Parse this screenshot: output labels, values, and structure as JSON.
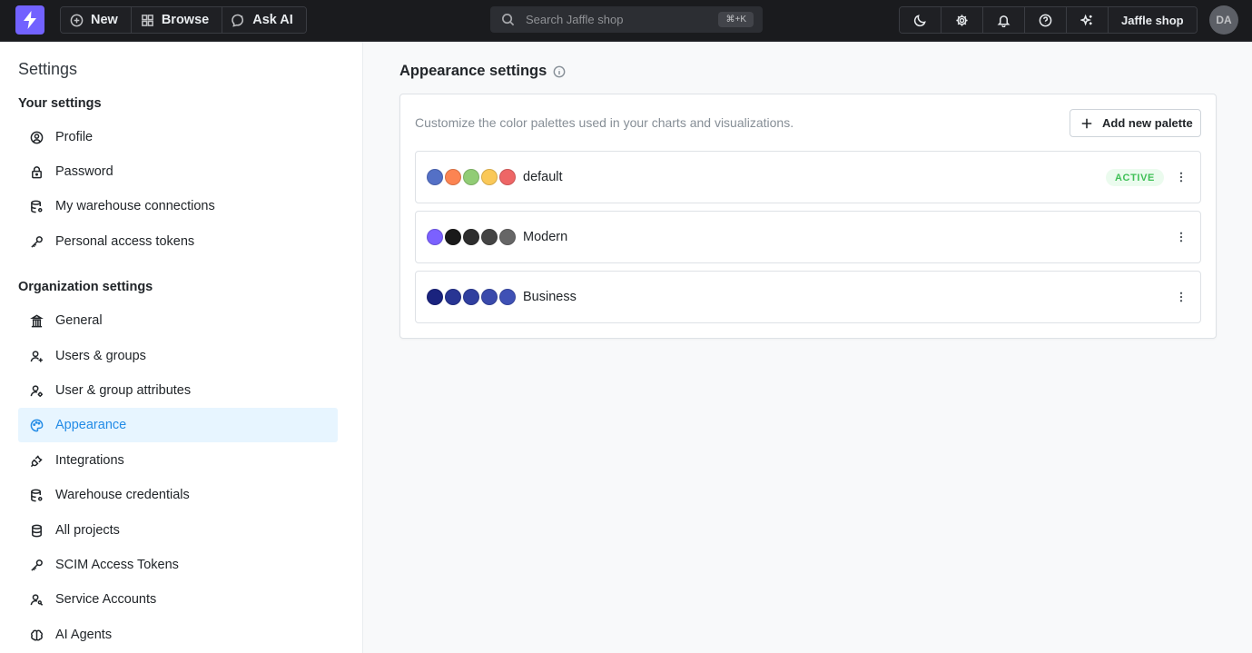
{
  "topbar": {
    "new_label": "New",
    "browse_label": "Browse",
    "ask_ai_label": "Ask AI",
    "search_placeholder": "Search Jaffle shop",
    "search_shortcut": "⌘+K",
    "project_label": "Jaffle shop",
    "avatar_initials": "DA"
  },
  "sidebar": {
    "title": "Settings",
    "your_settings_title": "Your settings",
    "your_settings": [
      {
        "label": "Profile",
        "icon": "user-circle-icon"
      },
      {
        "label": "Password",
        "icon": "lock-icon"
      },
      {
        "label": "My warehouse connections",
        "icon": "database-cog-icon"
      },
      {
        "label": "Personal access tokens",
        "icon": "key-icon"
      }
    ],
    "org_settings_title": "Organization settings",
    "org_settings": [
      {
        "label": "General",
        "icon": "building-bank-icon"
      },
      {
        "label": "Users & groups",
        "icon": "user-plus-icon"
      },
      {
        "label": "User & group attributes",
        "icon": "user-cog-icon"
      },
      {
        "label": "Appearance",
        "icon": "palette-icon",
        "active": true
      },
      {
        "label": "Integrations",
        "icon": "plug-icon"
      },
      {
        "label": "Warehouse credentials",
        "icon": "database-cog-icon"
      },
      {
        "label": "All projects",
        "icon": "database-icon"
      },
      {
        "label": "SCIM Access Tokens",
        "icon": "key-icon"
      },
      {
        "label": "Service Accounts",
        "icon": "user-key-icon"
      },
      {
        "label": "AI Agents",
        "icon": "brain-icon"
      }
    ]
  },
  "main": {
    "title": "Appearance settings",
    "description": "Customize the color palettes used in your charts and visualizations.",
    "add_palette_label": "Add new palette",
    "palettes": [
      {
        "name": "default",
        "colors": [
          "#5470c6",
          "#fc8452",
          "#91cc75",
          "#fac858",
          "#ee6666"
        ],
        "status": "ACTIVE"
      },
      {
        "name": "Modern",
        "colors": [
          "#7b61ff",
          "#1a1a1a",
          "#2d2d2d",
          "#444444",
          "#666666"
        ],
        "status": ""
      },
      {
        "name": "Business",
        "colors": [
          "#1a237e",
          "#283593",
          "#303f9f",
          "#3949ab",
          "#3f51b5"
        ],
        "status": ""
      }
    ]
  },
  "colors": {
    "brand": "#7262ff",
    "active_nav_bg": "#e7f5ff",
    "active_nav_text": "#228be6",
    "active_badge_bg": "#ebfbee",
    "active_badge_text": "#40c057"
  }
}
